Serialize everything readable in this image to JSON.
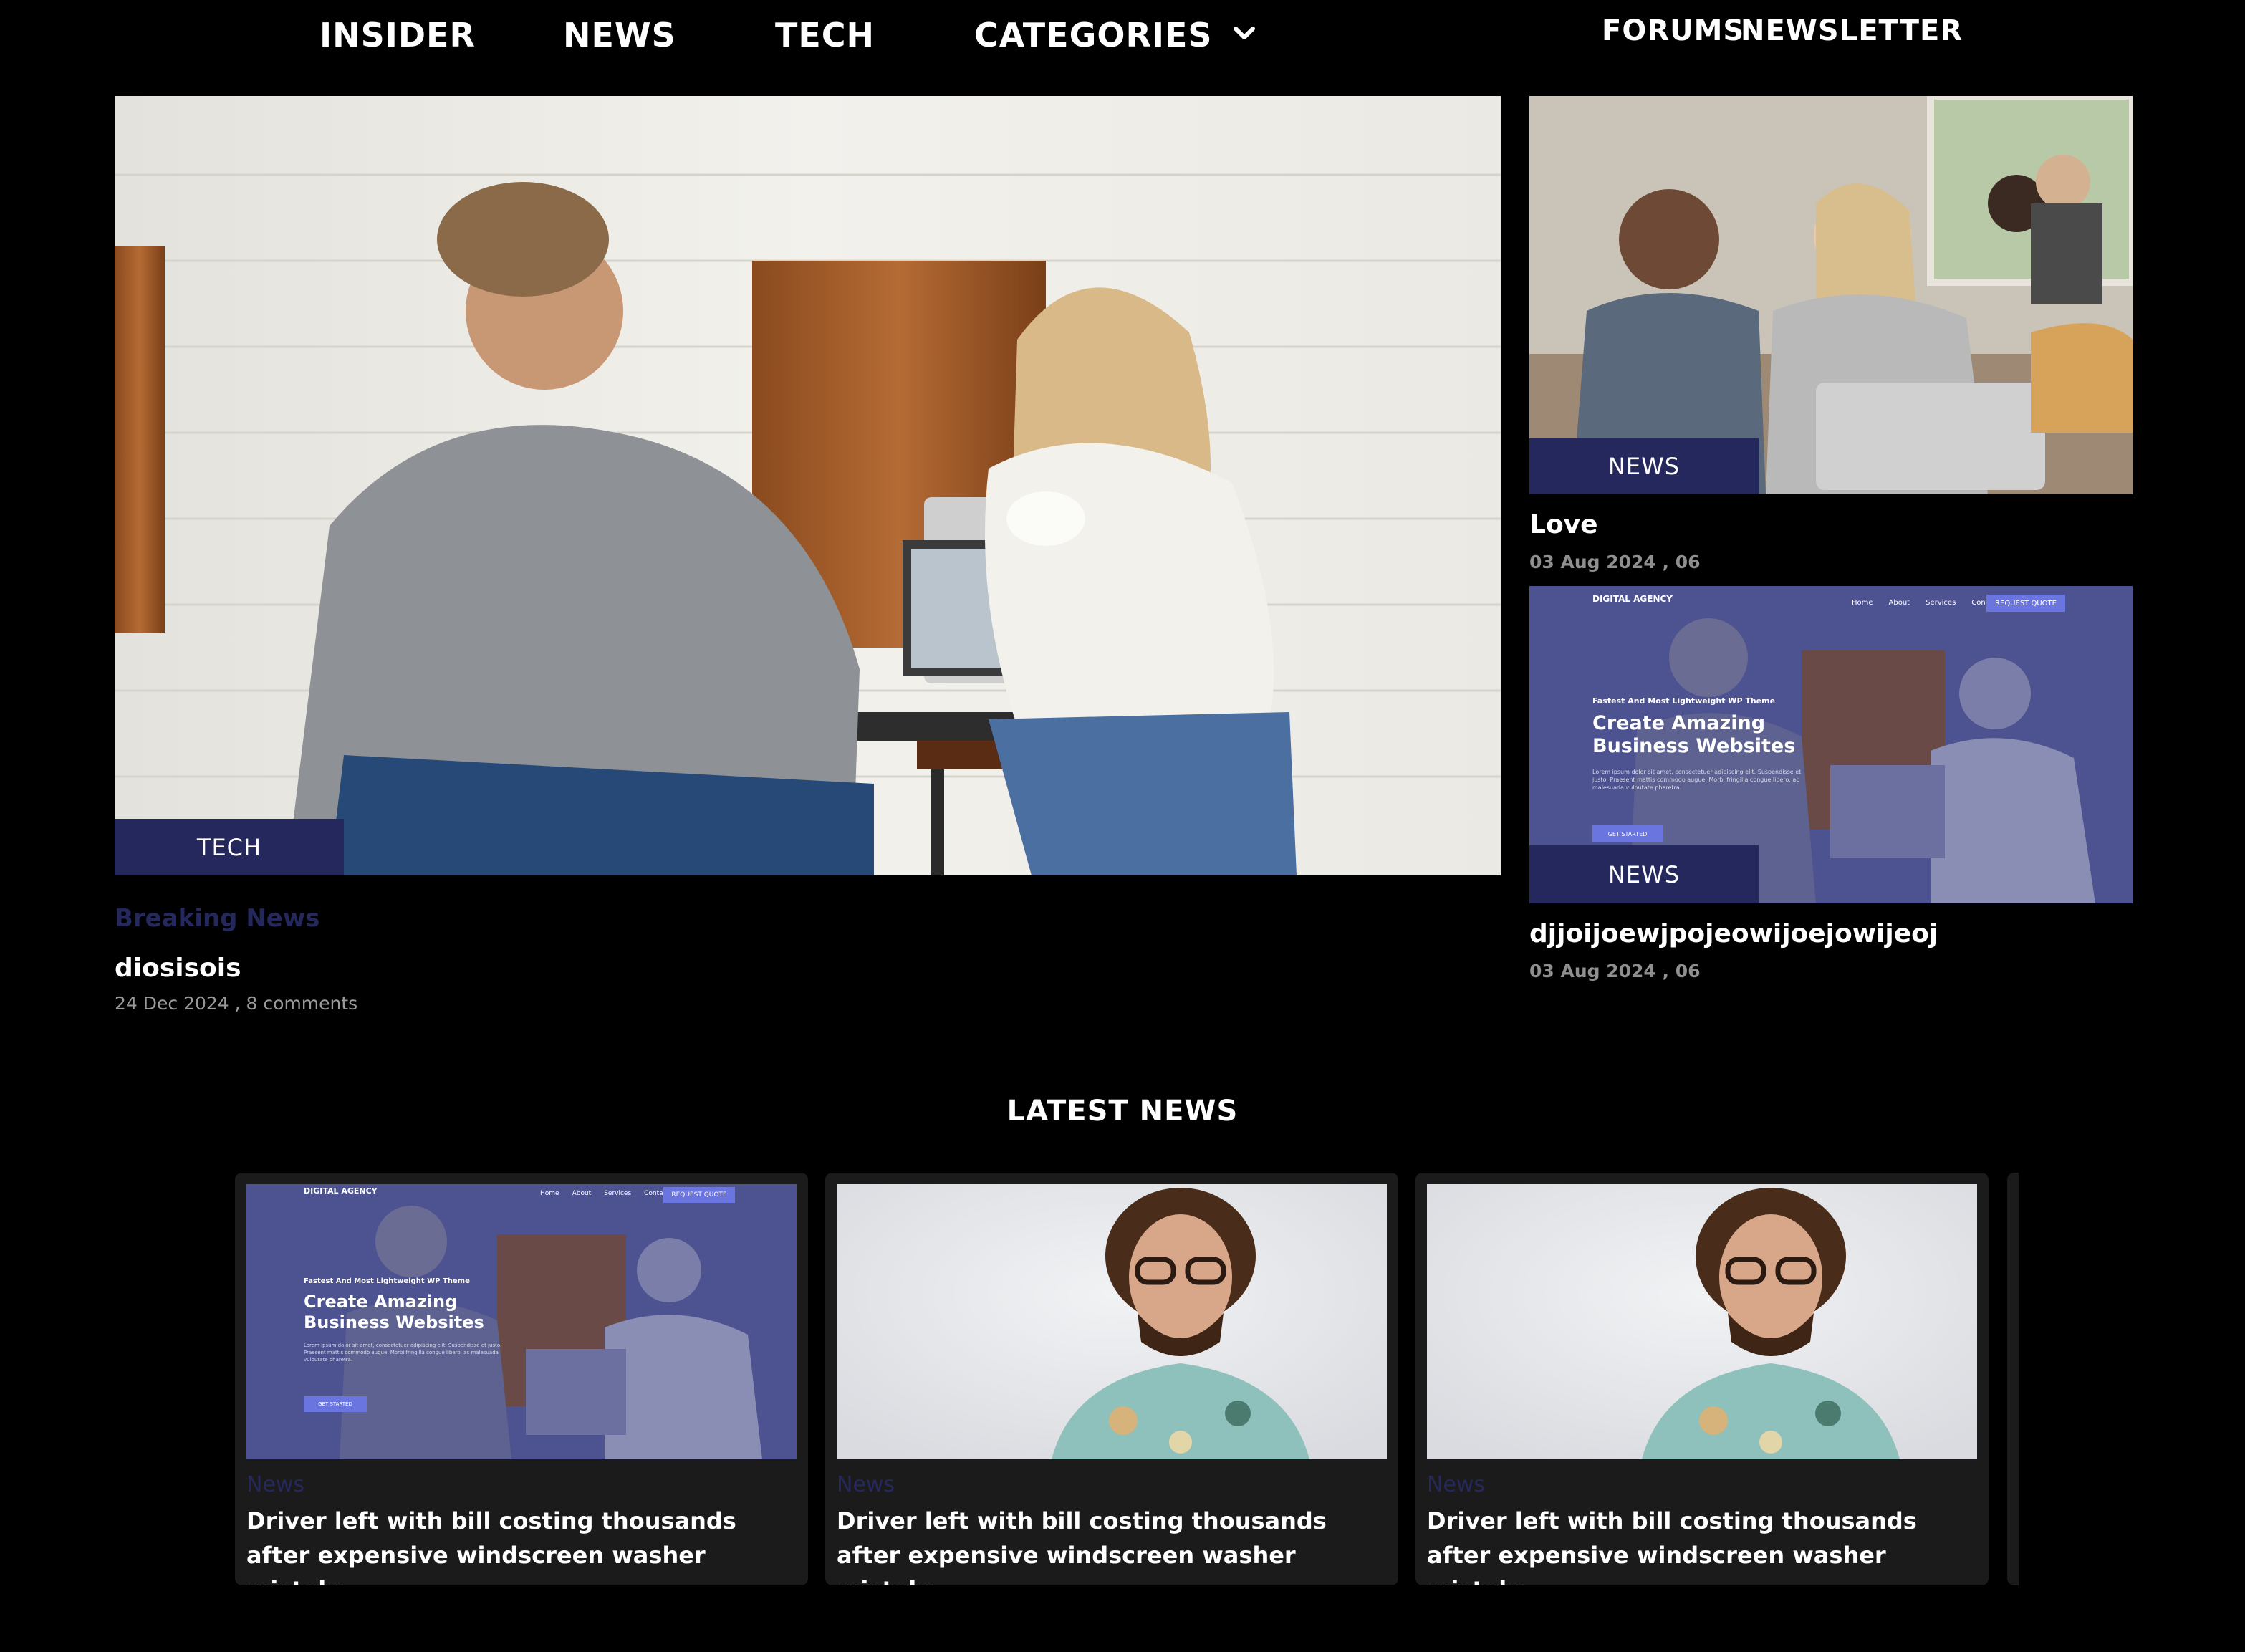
{
  "nav": {
    "left": [
      "INSIDER",
      "NEWS",
      "TECH",
      "CATEGORIES"
    ],
    "right": [
      "FORUMS",
      "NEWSLETTER"
    ]
  },
  "hero": {
    "badge": "TECH",
    "kicker": "Breaking News",
    "title": "diosisois",
    "meta": "24 Dec 2024 , 8 comments"
  },
  "side": [
    {
      "badge": "NEWS",
      "title": "Love",
      "meta": "03 Aug 2024 , 06"
    },
    {
      "badge": "NEWS",
      "title": "djjoijoewjpojeowijoejowijeoj",
      "meta": "03 Aug 2024 , 06"
    }
  ],
  "mock_site": {
    "logo": "DIGITAL AGENCY",
    "menu": [
      "Home",
      "About",
      "Services",
      "Contact"
    ],
    "cta": "REQUEST QUOTE",
    "eyebrow": "Fastest And Most Lightweight WP Theme",
    "headline_1": "Create Amazing",
    "headline_2": "Business Websites",
    "body": "Lorem ipsum dolor sit amet, consectetuer adipiscing elit. Suspendisse et justo. Praesent mattis commodo augue. Morbi fringilla congue libero, ac malesuada vulputate pharetra.",
    "button": "GET STARTED"
  },
  "latest": {
    "title": "LATEST NEWS",
    "cards": [
      {
        "category": "News",
        "headline": "Driver left with bill costing thousands after expensive windscreen washer mistake",
        "image": "digital-agency-screenshot"
      },
      {
        "category": "News",
        "headline": "Driver left with bill costing thousands after expensive windscreen washer mistake",
        "image": "smiling-man-portrait"
      },
      {
        "category": "News",
        "headline": "Driver left with bill costing thousands after expensive windscreen washer mistake",
        "image": "smiling-man-portrait"
      }
    ]
  },
  "colors": {
    "badge_bg": "#25285c",
    "card_bg": "#1b1b1b",
    "page_bg": "#000000"
  }
}
